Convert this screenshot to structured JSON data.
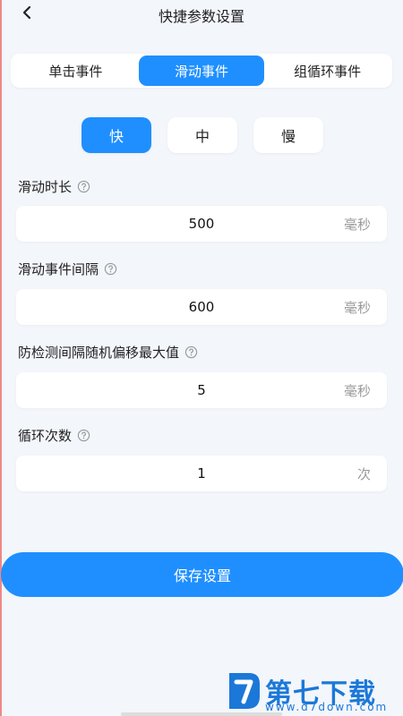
{
  "header": {
    "title": "快捷参数设置",
    "back_icon": "chevron-left-icon"
  },
  "tabs": [
    {
      "label": "单击事件",
      "active": false
    },
    {
      "label": "滑动事件",
      "active": true
    },
    {
      "label": "组循环事件",
      "active": false
    }
  ],
  "speed": [
    {
      "label": "快",
      "active": true
    },
    {
      "label": "中",
      "active": false
    },
    {
      "label": "慢",
      "active": false
    }
  ],
  "fields": [
    {
      "label": "滑动时长",
      "value": "500",
      "unit": "毫秒"
    },
    {
      "label": "滑动事件间隔",
      "value": "600",
      "unit": "毫秒"
    },
    {
      "label": "防检测间隔随机偏移最大值",
      "value": "5",
      "unit": "毫秒"
    },
    {
      "label": "循环次数",
      "value": "1",
      "unit": "次"
    }
  ],
  "save_label": "保存设置",
  "watermark": {
    "brand": "第七下载站",
    "url": "www.d7down.com"
  },
  "colors": {
    "accent": "#1f8fff",
    "background": "#f3f6fb",
    "unit_text": "#999999",
    "watermark": "#1b78d8"
  }
}
